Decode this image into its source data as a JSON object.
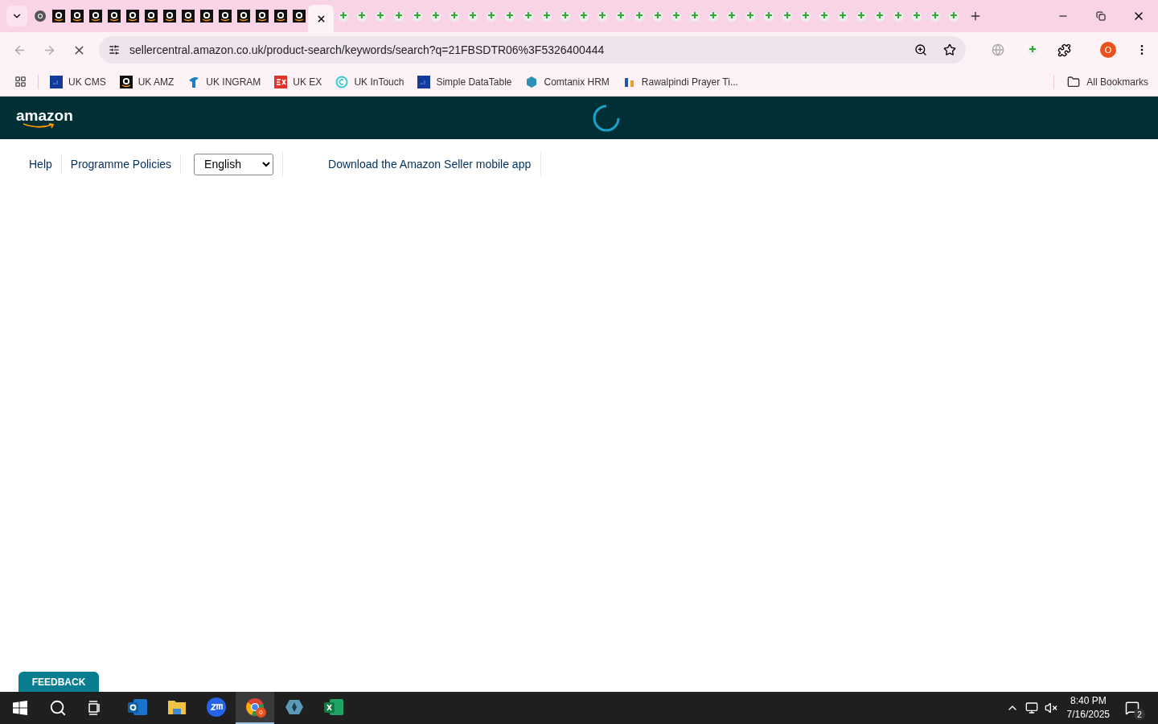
{
  "browser": {
    "tabs": [
      {
        "kind": "chrome",
        "selected": false
      },
      {
        "kind": "amazon",
        "selected": false
      },
      {
        "kind": "amazon",
        "selected": false
      },
      {
        "kind": "amazon",
        "selected": false
      },
      {
        "kind": "amazon",
        "selected": false
      },
      {
        "kind": "amazon",
        "selected": false
      },
      {
        "kind": "amazon",
        "selected": false
      },
      {
        "kind": "amazon",
        "selected": false
      },
      {
        "kind": "amazon",
        "selected": false
      },
      {
        "kind": "amazon",
        "selected": false
      },
      {
        "kind": "amazon",
        "selected": false
      },
      {
        "kind": "amazon",
        "selected": false
      },
      {
        "kind": "amazon",
        "selected": false
      },
      {
        "kind": "amazon",
        "selected": false
      },
      {
        "kind": "amazon",
        "selected": false
      },
      {
        "kind": "loading",
        "selected": true
      },
      {
        "kind": "plus",
        "selected": false
      },
      {
        "kind": "plus",
        "selected": false
      },
      {
        "kind": "plus",
        "selected": false
      },
      {
        "kind": "plus",
        "selected": false
      },
      {
        "kind": "plus",
        "selected": false
      },
      {
        "kind": "plus",
        "selected": false
      },
      {
        "kind": "plus",
        "selected": false
      },
      {
        "kind": "plus",
        "selected": false
      },
      {
        "kind": "plus",
        "selected": false
      },
      {
        "kind": "plus",
        "selected": false
      },
      {
        "kind": "plus",
        "selected": false
      },
      {
        "kind": "plus",
        "selected": false
      },
      {
        "kind": "plus",
        "selected": false
      },
      {
        "kind": "plus",
        "selected": false
      },
      {
        "kind": "plus",
        "selected": false
      },
      {
        "kind": "plus",
        "selected": false
      },
      {
        "kind": "plus",
        "selected": false
      },
      {
        "kind": "plus",
        "selected": false
      },
      {
        "kind": "plus",
        "selected": false
      },
      {
        "kind": "plus",
        "selected": false
      },
      {
        "kind": "plus",
        "selected": false
      },
      {
        "kind": "plus",
        "selected": false
      },
      {
        "kind": "plus",
        "selected": false
      },
      {
        "kind": "plus",
        "selected": false
      },
      {
        "kind": "plus",
        "selected": false
      },
      {
        "kind": "plus",
        "selected": false
      },
      {
        "kind": "plus",
        "selected": false
      },
      {
        "kind": "plus",
        "selected": false
      },
      {
        "kind": "plus",
        "selected": false
      },
      {
        "kind": "plus",
        "selected": false
      },
      {
        "kind": "plus",
        "selected": false
      },
      {
        "kind": "plus",
        "selected": false
      },
      {
        "kind": "plus",
        "selected": false
      },
      {
        "kind": "plus",
        "selected": false
      }
    ],
    "url": "sellercentral.amazon.co.uk/product-search/keywords/search?q=21FBSDTR06%3F5326400444",
    "profile_initial": "O",
    "bookmarks": [
      {
        "label": "UK CMS",
        "kind": "df"
      },
      {
        "label": "UK AMZ",
        "kind": "amazon"
      },
      {
        "label": "UK INGRAM",
        "kind": "ingram"
      },
      {
        "label": "UK EX",
        "kind": "ex"
      },
      {
        "label": "UK InTouch",
        "kind": "intouch"
      },
      {
        "label": "Simple DataTable",
        "kind": "df"
      },
      {
        "label": "Comtanix HRM",
        "kind": "hrm"
      },
      {
        "label": "Rawalpindi Prayer Ti...",
        "kind": "prayer"
      }
    ],
    "all_bookmarks": "All Bookmarks"
  },
  "page": {
    "logo": "amazon",
    "loading": true,
    "nav_links": [
      "Help",
      "Programme Policies"
    ],
    "language": "English",
    "app_link": "Download the Amazon Seller mobile app",
    "feedback": "FEEDBACK"
  },
  "taskbar": {
    "apps": [
      {
        "kind": "outlook",
        "active": false
      },
      {
        "kind": "files",
        "active": false
      },
      {
        "kind": "zoom",
        "active": false
      },
      {
        "kind": "chrome",
        "active": true,
        "badge": "0"
      },
      {
        "kind": "diamond",
        "active": false
      },
      {
        "kind": "excel",
        "active": false
      }
    ],
    "time": "8:40 PM",
    "date": "7/16/2025",
    "notifications": "2"
  }
}
